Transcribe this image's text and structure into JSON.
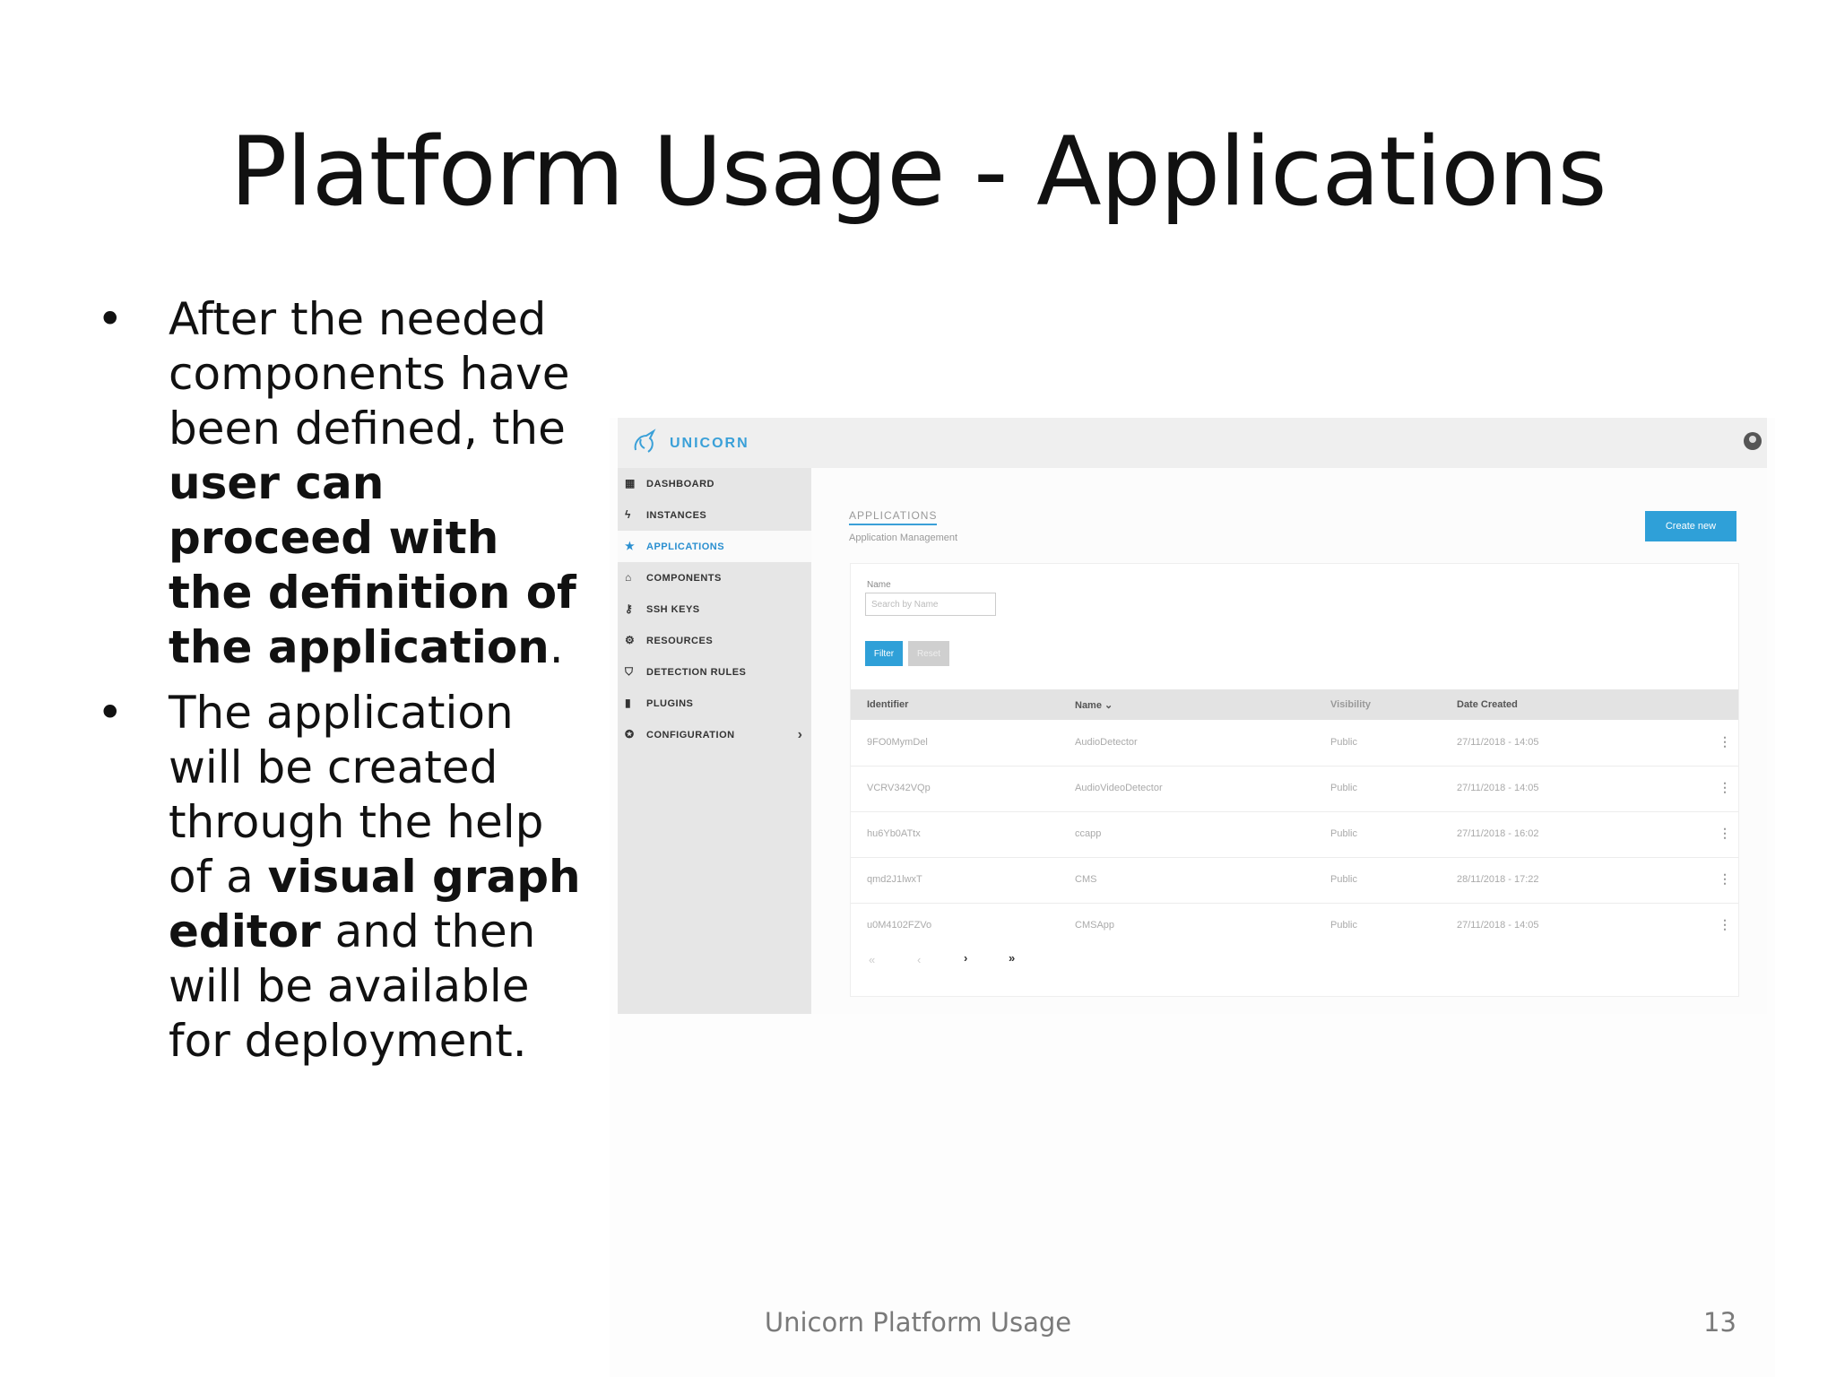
{
  "slide": {
    "title": "Platform Usage - Applications",
    "bullet1": {
      "p1": "After the needed components have been defined, the ",
      "b1": "user can proceed with the definition of the application",
      "p2": "."
    },
    "bullet2": {
      "p1": "The application will be created through the help of a ",
      "b1": "visual graph editor",
      "p2": " and then will be available for deployment."
    },
    "footer": "Unicorn Platform Usage",
    "page_number": "13"
  },
  "app": {
    "brand": "UNICORN",
    "nav": [
      {
        "label": "DASHBOARD",
        "icon": "dashboard-icon"
      },
      {
        "label": "INSTANCES",
        "icon": "bolt-icon"
      },
      {
        "label": "APPLICATIONS",
        "icon": "star-icon",
        "active": true
      },
      {
        "label": "COMPONENTS",
        "icon": "home-icon"
      },
      {
        "label": "SSH KEYS",
        "icon": "key-icon"
      },
      {
        "label": "RESOURCES",
        "icon": "gears-icon"
      },
      {
        "label": "DETECTION RULES",
        "icon": "shield-icon"
      },
      {
        "label": "PLUGINS",
        "icon": "plug-icon"
      },
      {
        "label": "CONFIGURATION",
        "icon": "cog-icon"
      }
    ],
    "breadcrumb": "APPLICATIONS",
    "subtitle": "Application Management",
    "create_button": "Create new",
    "filter": {
      "name_label": "Name",
      "search_placeholder": "Search by Name",
      "filter_button": "Filter",
      "reset_button": "Reset"
    },
    "table": {
      "headers": [
        "Identifier",
        "Name",
        "Visibility",
        "Date Created"
      ],
      "rows": [
        [
          "9FO0MymDel",
          "AudioDetector",
          "Public",
          "27/11/2018 - 14:05"
        ],
        [
          "VCRV342VQp",
          "AudioVideoDetector",
          "Public",
          "27/11/2018 - 14:05"
        ],
        [
          "hu6Yb0ATtx",
          "ccapp",
          "Public",
          "27/11/2018 - 16:02"
        ],
        [
          "qmd2J1lwxT",
          "CMS",
          "Public",
          "28/11/2018 - 17:22"
        ],
        [
          "u0M4102FZVo",
          "CMSApp",
          "Public",
          "27/11/2018 - 14:05"
        ]
      ]
    },
    "pager": [
      "«",
      "‹",
      "›",
      "»"
    ],
    "colors": {
      "accent": "#2fa0d8",
      "sidebar": "#e6e6e6",
      "topbar": "#efefef"
    }
  }
}
